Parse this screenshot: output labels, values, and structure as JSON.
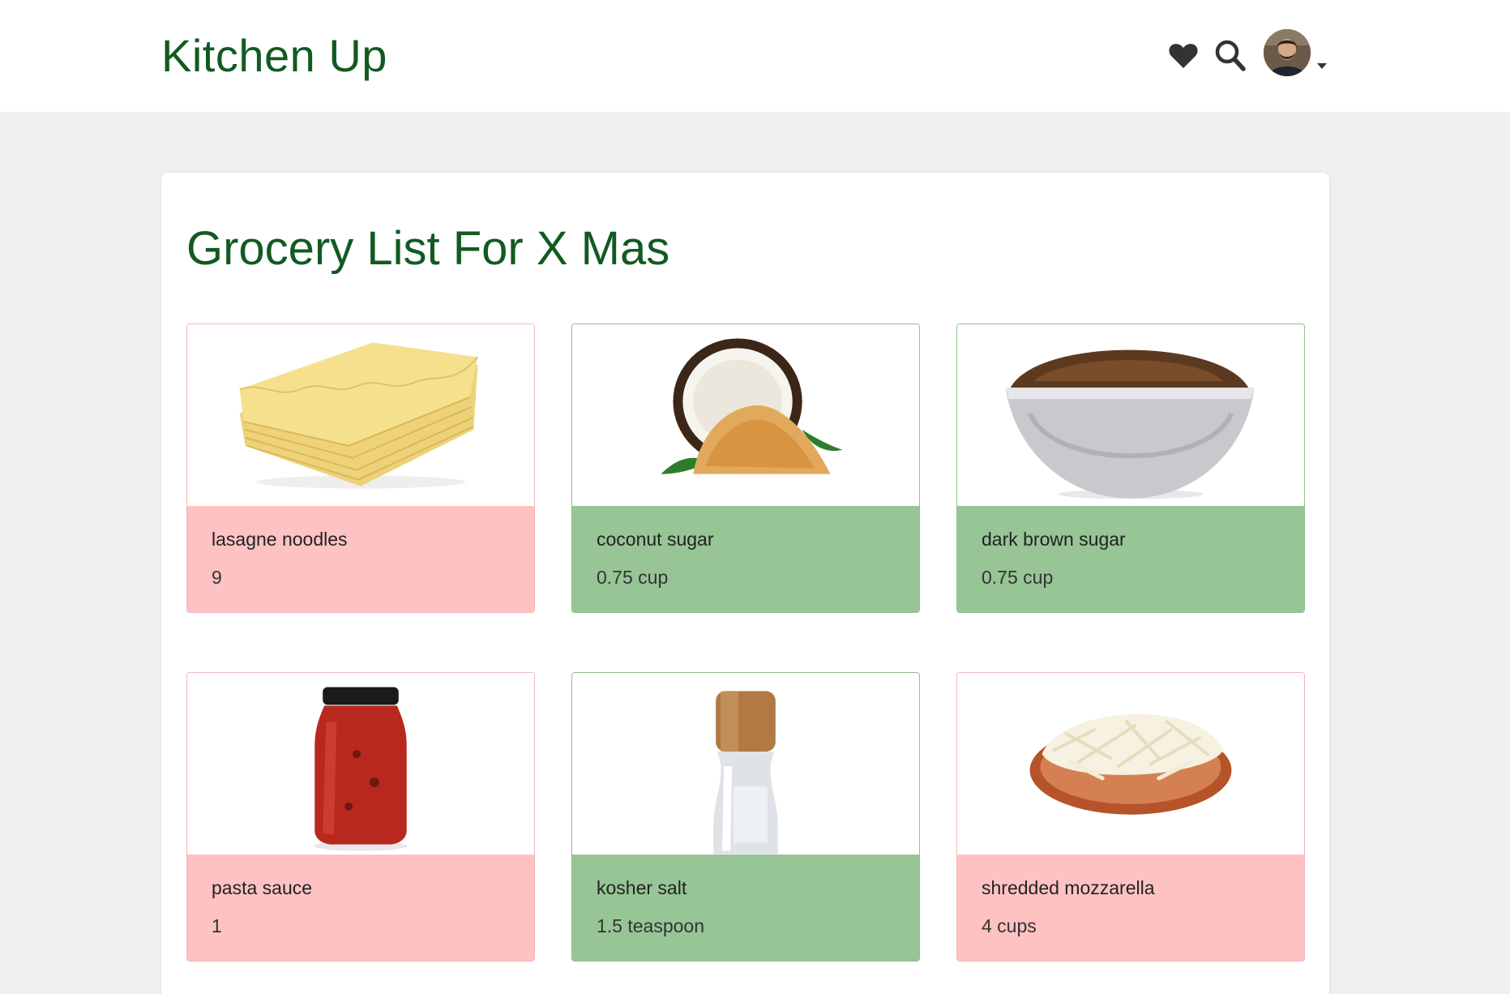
{
  "header": {
    "brand": "Kitchen Up",
    "icons": [
      "heart-icon",
      "search-icon",
      "avatar",
      "caret-down-icon"
    ]
  },
  "main": {
    "title": "Grocery List For X Mas",
    "items": [
      {
        "name": "lasagne noodles",
        "quantity": "9",
        "status": "needed",
        "image": "lasagne-noodles-image"
      },
      {
        "name": "coconut sugar",
        "quantity": "0.75 cup",
        "status": "have",
        "image": "coconut-sugar-image"
      },
      {
        "name": "dark brown sugar",
        "quantity": "0.75 cup",
        "status": "have",
        "image": "brown-sugar-image"
      },
      {
        "name": "pasta sauce",
        "quantity": "1",
        "status": "needed",
        "image": "pasta-sauce-image"
      },
      {
        "name": "kosher salt",
        "quantity": "1.5 teaspoon",
        "status": "have",
        "image": "kosher-salt-image"
      },
      {
        "name": "shredded mozzarella",
        "quantity": "4 cups",
        "status": "needed",
        "image": "mozzarella-image"
      }
    ]
  },
  "colors": {
    "brand": "#125a22",
    "needed": "#ffc2c3",
    "have": "#97c596",
    "page_bg": "#f0f0f0"
  }
}
